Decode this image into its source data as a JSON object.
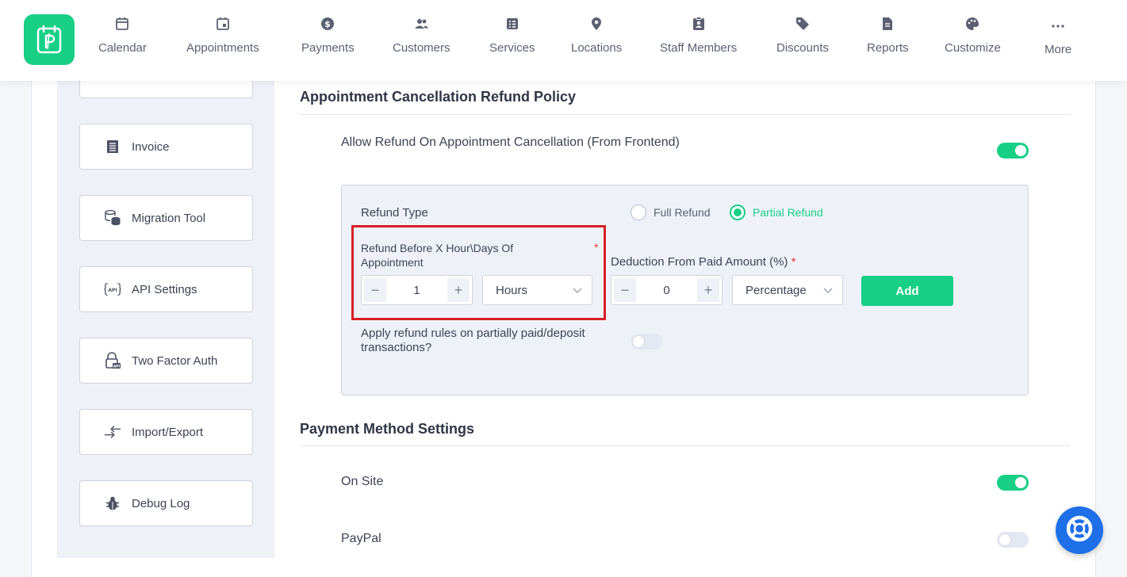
{
  "nav": {
    "items": [
      {
        "label": "Calendar",
        "icon": "calendar-icon"
      },
      {
        "label": "Appointments",
        "icon": "appointments-icon"
      },
      {
        "label": "Payments",
        "icon": "dollar-coin-icon"
      },
      {
        "label": "Customers",
        "icon": "users-icon"
      },
      {
        "label": "Services",
        "icon": "services-list-icon"
      },
      {
        "label": "Locations",
        "icon": "location-pin-icon"
      },
      {
        "label": "Staff Members",
        "icon": "staff-badge-icon"
      },
      {
        "label": "Discounts",
        "icon": "tag-icon"
      },
      {
        "label": "Reports",
        "icon": "report-file-icon"
      },
      {
        "label": "Customize",
        "icon": "palette-icon"
      },
      {
        "label": "More",
        "icon": "more-dots-icon"
      }
    ]
  },
  "sidebar": {
    "items": [
      {
        "label": "Invoice",
        "icon": "invoice-icon"
      },
      {
        "label": "Migration Tool",
        "icon": "database-migration-icon"
      },
      {
        "label": "API Settings",
        "icon": "api-icon"
      },
      {
        "label": "Two Factor Auth",
        "icon": "lock-key-icon"
      },
      {
        "label": "Import/Export",
        "icon": "import-export-arrows-icon"
      },
      {
        "label": "Debug Log",
        "icon": "bug-icon"
      }
    ]
  },
  "refund_policy": {
    "title": "Appointment Cancellation Refund Policy",
    "allow_refund_label": "Allow Refund On Appointment Cancellation (From Frontend)",
    "allow_refund_enabled": true,
    "refund_type_label": "Refund Type",
    "refund_type_options": [
      "Full Refund",
      "Partial Refund"
    ],
    "refund_type_selected": "Partial Refund",
    "refund_before_label": "Refund Before X Hour\\Days Of Appointment",
    "refund_before_value": "1",
    "refund_unit": "Hours",
    "deduction_label": "Deduction From Paid Amount (%)",
    "deduction_value": "0",
    "deduction_unit": "Percentage",
    "add_label": "Add",
    "partial_rules_label": "Apply refund rules on partially paid/deposit transactions?",
    "partial_rules_enabled": false,
    "required_mark": "*"
  },
  "payment_methods": {
    "title": "Payment Method Settings",
    "items": [
      {
        "label": "On Site",
        "enabled": true
      },
      {
        "label": "PayPal",
        "enabled": false
      }
    ]
  },
  "colors": {
    "accent": "#18cf86",
    "highlight": "#d81f26",
    "help": "#1e6fe8"
  }
}
